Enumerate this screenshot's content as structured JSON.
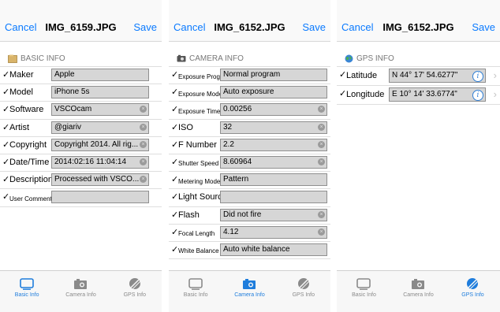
{
  "tabs": [
    "Basic Info",
    "Camera Info",
    "GPS Info"
  ],
  "panels": [
    {
      "cancel": "Cancel",
      "title": "IMG_6159.JPG",
      "save": "Save",
      "section": "BASIC INFO",
      "rows": [
        {
          "label": "Maker",
          "value": "Apple"
        },
        {
          "label": "Model",
          "value": "iPhone 5s"
        },
        {
          "label": "Software",
          "value": "VSCOcam"
        },
        {
          "label": "Artist",
          "value": "@giariv"
        },
        {
          "label": "Copyright",
          "value": "Copyright 2014. All rig..."
        },
        {
          "label": "Date/Time",
          "value": "2014:02:16 11:04:14"
        },
        {
          "label": "Description",
          "value": "Processed with VSCO..."
        },
        {
          "label": "User Comment",
          "value": ""
        }
      ]
    },
    {
      "cancel": "Cancel",
      "title": "IMG_6152.JPG",
      "save": "Save",
      "section": "CAMERA INFO",
      "rows": [
        {
          "label": "Exposure Progr...",
          "value": "Normal program"
        },
        {
          "label": "Exposure Mode",
          "value": "Auto exposure"
        },
        {
          "label": "Exposure Time",
          "value": "0.00256"
        },
        {
          "label": "ISO",
          "value": "32"
        },
        {
          "label": "F Number",
          "value": "2.2"
        },
        {
          "label": "Shutter Speed",
          "value": "8.60964"
        },
        {
          "label": "Metering Mode",
          "value": "Pattern"
        },
        {
          "label": "Light Source",
          "value": ""
        },
        {
          "label": "Flash",
          "value": "Did not fire"
        },
        {
          "label": "Focal Length",
          "value": "4.12"
        },
        {
          "label": "White Balance",
          "value": "Auto white balance"
        }
      ]
    },
    {
      "cancel": "Cancel",
      "title": "IMG_6152.JPG",
      "save": "Save",
      "section": "GPS INFO",
      "rows": [
        {
          "label": "Latitude",
          "value": "N 44° 17' 54.6277\""
        },
        {
          "label": "Longitude",
          "value": "E 10° 14' 33.6774\""
        }
      ]
    }
  ],
  "glyphs": {
    "check": "✓",
    "clear": "×",
    "info": "i",
    "chevron": "›"
  },
  "colors": {
    "accent": "#0a7aff",
    "tab_active": "#1f7ddc",
    "field_bg": "#d6d6d6"
  }
}
